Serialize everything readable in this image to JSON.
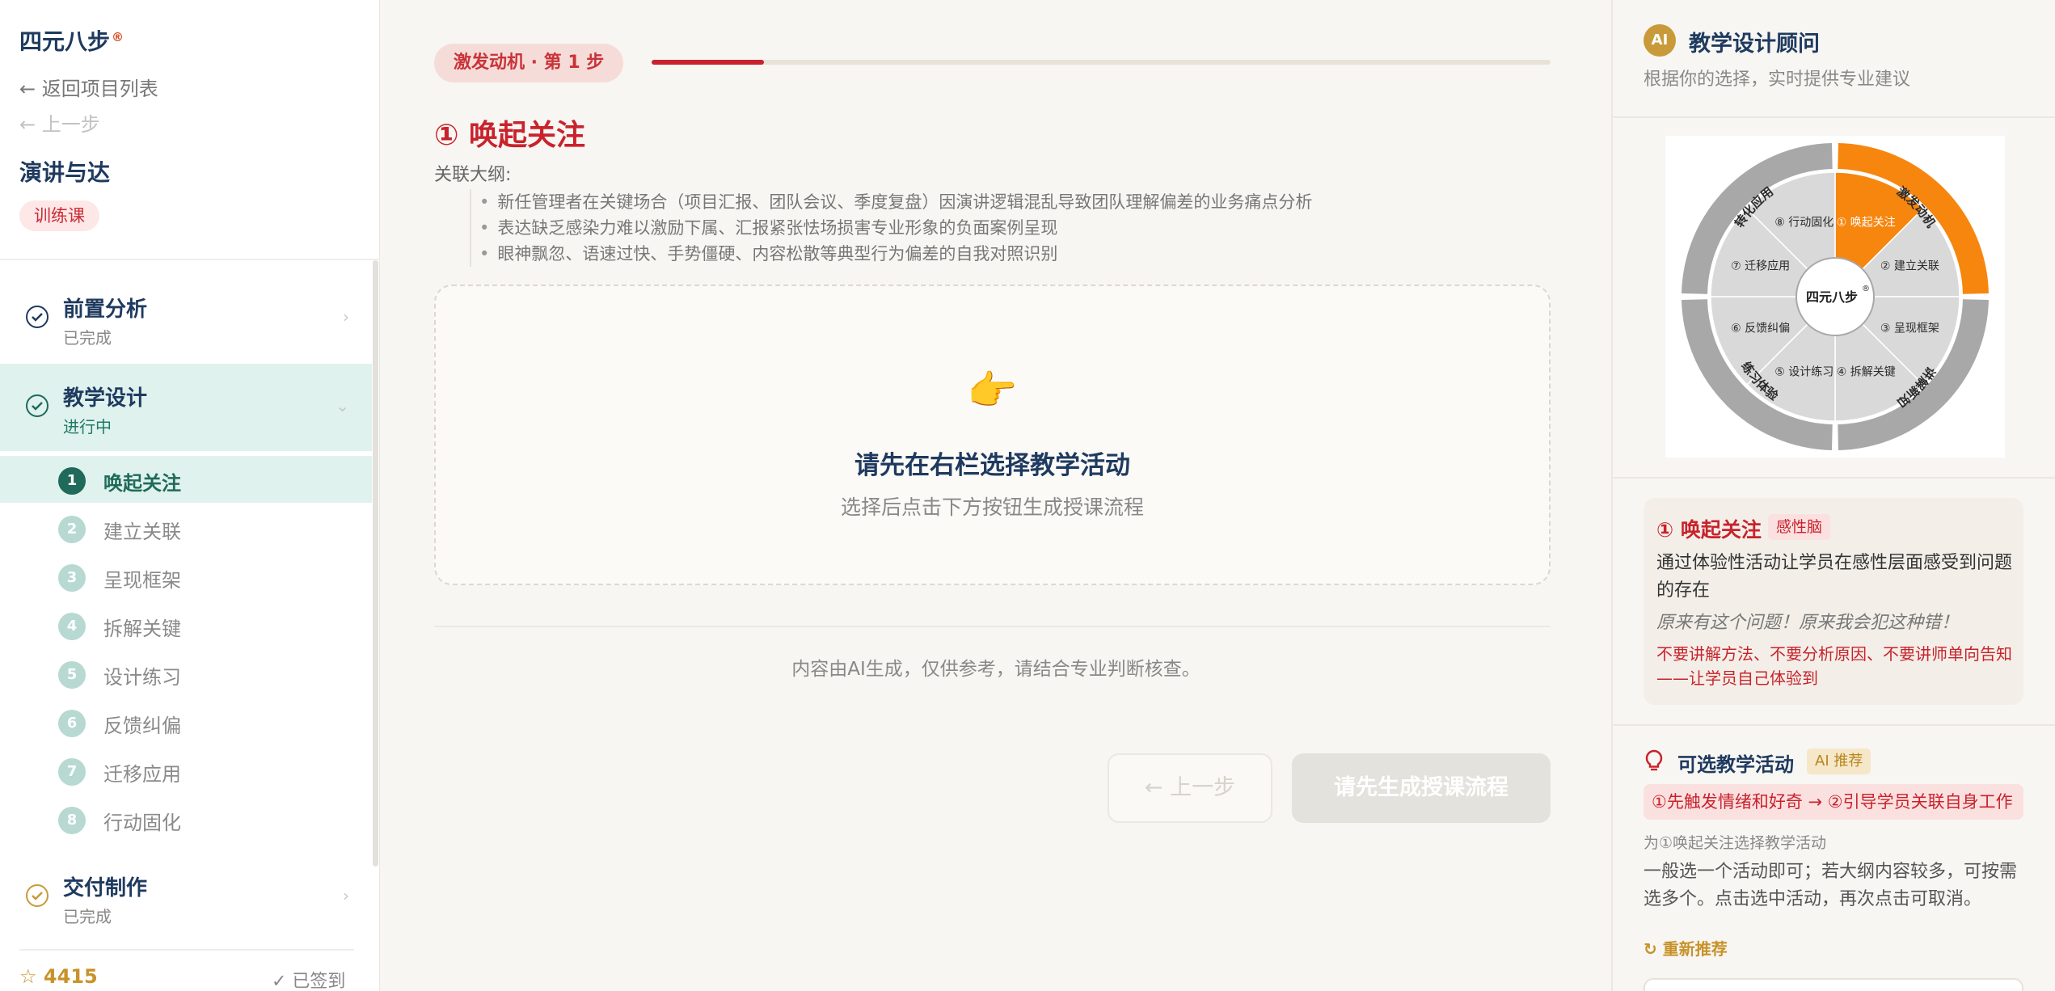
{
  "sidebar": {
    "brand": "四元八步",
    "brand_mark": "®",
    "back_link": "← 返回项目列表",
    "prev_link": "← 上一步",
    "project_title": "演讲与达",
    "course_type": "训练课",
    "stages": [
      {
        "title": "前置分析",
        "status": "已完成"
      },
      {
        "title": "教学设计",
        "status": "进行中"
      },
      {
        "title": "交付制作",
        "status": "已完成"
      }
    ],
    "steps": [
      {
        "num": "1",
        "label": "唤起关注"
      },
      {
        "num": "2",
        "label": "建立关联"
      },
      {
        "num": "3",
        "label": "呈现框架"
      },
      {
        "num": "4",
        "label": "拆解关键"
      },
      {
        "num": "5",
        "label": "设计练习"
      },
      {
        "num": "6",
        "label": "反馈纠偏"
      },
      {
        "num": "7",
        "label": "迁移应用"
      },
      {
        "num": "8",
        "label": "行动固化"
      }
    ],
    "points": "☆ 4415",
    "signed": "✓ 已签到"
  },
  "main": {
    "step_pill": "激发动机 · 第 1 步",
    "progress": 0.125,
    "title": "① 唤起关注",
    "outline_label": "关联大纲:",
    "outline": [
      "新任管理者在关键场合（项目汇报、团队会议、季度复盘）因演讲逻辑混乱导致团队理解偏差的业务痛点分析",
      "表达缺乏感染力难以激励下属、汇报紧张怯场损害专业形象的负面案例呈现",
      "眼神飘忽、语速过快、手势僵硬、内容松散等典型行为偏差的自我对照识别"
    ],
    "empty_emoji": "👉",
    "empty_title": "请先在右栏选择教学活动",
    "empty_sub": "选择后点击下方按钮生成授课流程",
    "ai_note": "内容由AI生成，仅供参考，请结合专业判断核查。",
    "prev_button": "← 上一步",
    "generate_button": "请先生成授课流程"
  },
  "rpanel": {
    "ai_badge": "AI",
    "title": "教学设计顾问",
    "subtitle": "根据你的选择，实时提供专业建议",
    "wheel": {
      "center": "四元八步",
      "center_mark": "®",
      "outer": [
        "激发动机",
        "讲解新知",
        "练习体验",
        "转化应用"
      ],
      "segments": [
        "① 唤起关注",
        "② 建立关联",
        "③ 呈现框架",
        "④ 拆解关键",
        "⑤ 设计练习",
        "⑥ 反馈纠偏",
        "⑦ 迁移应用",
        "⑧ 行动固化"
      ]
    },
    "card": {
      "title": "① 唤起关注",
      "tag": "感性脑",
      "desc": "通过体验性活动让学员在感性层面感受到问题的存在",
      "quote": "原来有这个问题！原来我会犯这种错！",
      "warn": "不要讲解方法、不要分析原因、不要讲师单向告知——让学员自己体验到"
    },
    "options": {
      "title": "可选教学活动",
      "tag": "AI 推荐",
      "flow": "①先触发情绪和好奇 → ②引导学员关联自身工作",
      "sub": "为①唤起关注选择教学活动",
      "desc": "一般选一个活动即可；若大纲内容较多，可按需选多个。点击选中活动，再次点击可取消。",
      "refresh": "↻ 重新推荐"
    },
    "colors": {
      "accent": "#f7860f",
      "gray": "#d9d9d9",
      "ring": "#a8a8a8"
    }
  }
}
